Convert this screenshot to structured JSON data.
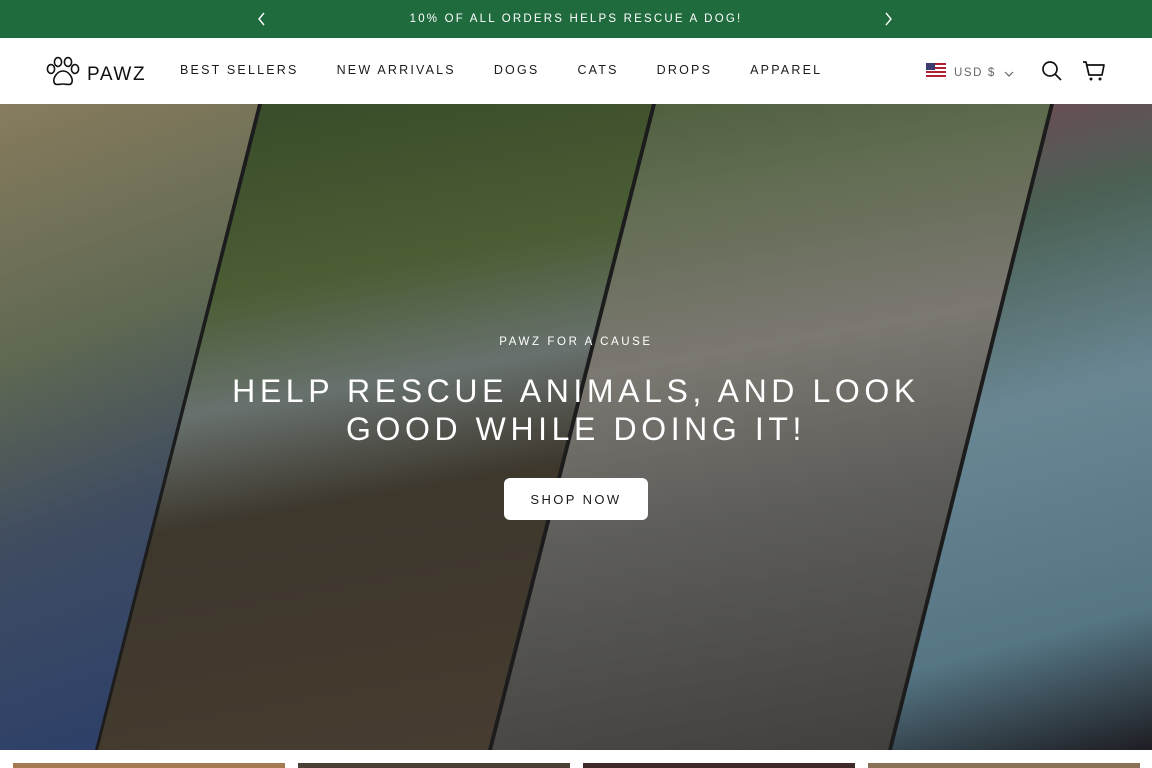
{
  "announcement": {
    "message": "10% OF ALL ORDERS HELPS RESCUE A DOG!",
    "prev_icon": "chevron-left-icon",
    "next_icon": "chevron-right-icon"
  },
  "header": {
    "logo_text": "PAWZ",
    "logo_icon": "paw-icon",
    "nav": [
      {
        "label": "BEST SELLERS"
      },
      {
        "label": "NEW ARRIVALS"
      },
      {
        "label": "DOGS"
      },
      {
        "label": "CATS"
      },
      {
        "label": "DROPS"
      },
      {
        "label": "APPAREL"
      }
    ],
    "currency": {
      "label": "USD $",
      "flag_icon": "us-flag-icon"
    },
    "search_icon": "search-icon",
    "cart_icon": "shopping-bag-icon"
  },
  "hero": {
    "eyebrow": "PAWZ FOR A CAUSE",
    "title": "HELP RESCUE ANIMALS, AND LOOK GOOD WHILE DOING IT!",
    "cta_label": "SHOP NOW"
  },
  "colors": {
    "announcement_bg": "#1f6b3e",
    "text": "#1c1c1c",
    "hero_text": "#ffffff"
  }
}
